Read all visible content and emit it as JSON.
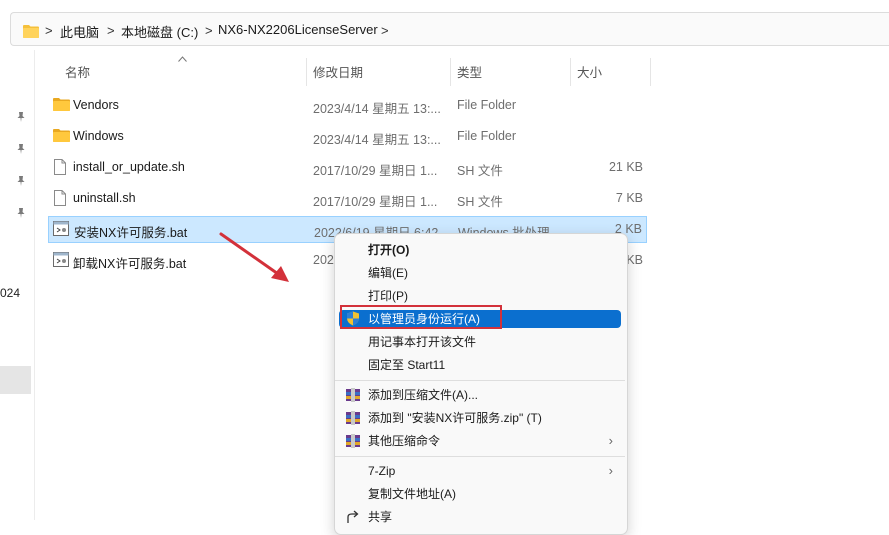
{
  "address_bar": {
    "crumbs": [
      "此电脑",
      "本地磁盘 (C:)",
      "NX6-NX2206LicenseServer"
    ],
    "separator": ">"
  },
  "nav_pane": {
    "partial_label": "024"
  },
  "columns": {
    "name": "名称",
    "date": "修改日期",
    "type": "类型",
    "size": "大小"
  },
  "files": [
    {
      "name": "Vendors",
      "date": "2023/4/14 星期五 13:...",
      "type": "File Folder",
      "size": "",
      "icon": "folder-icon"
    },
    {
      "name": "Windows",
      "date": "2023/4/14 星期五 13:...",
      "type": "File Folder",
      "size": "",
      "icon": "folder-icon"
    },
    {
      "name": "install_or_update.sh",
      "date": "2017/10/29 星期日 1...",
      "type": "SH 文件",
      "size": "21 KB",
      "icon": "file-icon"
    },
    {
      "name": "uninstall.sh",
      "date": "2017/10/29 星期日 1...",
      "type": "SH 文件",
      "size": "7 KB",
      "icon": "file-icon"
    },
    {
      "name": "安装NX许可服务.bat",
      "date": "2022/6/19 星期日 6:42",
      "type": "Windows 批处理...",
      "size": "2 KB",
      "icon": "batch-file-icon"
    },
    {
      "name": "卸载NX许可服务.bat",
      "date": "202",
      "type": "",
      "size": "KB",
      "icon": "batch-file-icon"
    }
  ],
  "context_menu": {
    "items": [
      {
        "label": "打开(O)",
        "icon": "",
        "bold": true
      },
      {
        "label": "编辑(E)",
        "icon": ""
      },
      {
        "label": "打印(P)",
        "icon": ""
      },
      {
        "label": "以管理员身份运行(A)",
        "icon": "uac-shield-icon",
        "highlighted": true
      },
      {
        "label": "用记事本打开该文件",
        "icon": ""
      },
      {
        "label": "固定至 Start11",
        "icon": ""
      },
      {
        "label": "添加到压缩文件(A)...",
        "icon": "winrar-icon"
      },
      {
        "label": "添加到 \"安装NX许可服务.zip\" (T)",
        "icon": "winrar-icon"
      },
      {
        "label": "其他压缩命令",
        "icon": "winrar-icon",
        "submenu": true
      },
      {
        "label": "7-Zip",
        "icon": "",
        "submenu": true
      },
      {
        "label": "复制文件地址(A)",
        "icon": ""
      },
      {
        "label": "共享",
        "icon": "share-icon"
      }
    ],
    "submenu_arrow": "›"
  },
  "colors": {
    "selection_bg": "#cce8ff",
    "menu_highlight": "#0b6fcf",
    "annotation_red": "#d3313a"
  }
}
